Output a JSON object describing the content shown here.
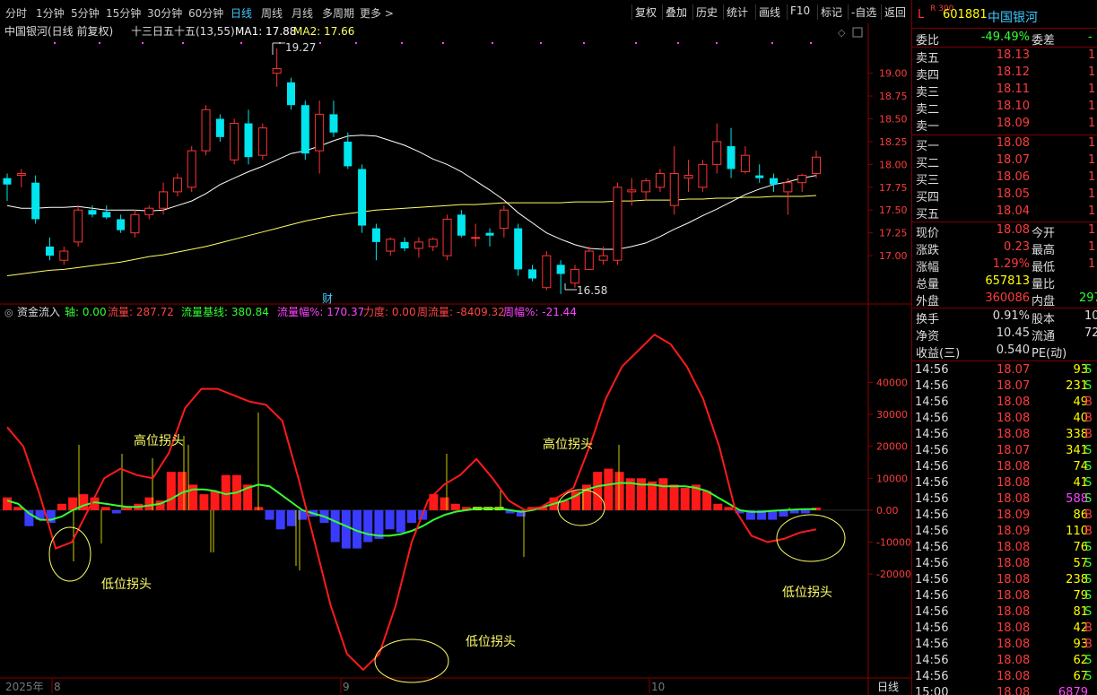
{
  "toolbar": {
    "timeframes": [
      "分时",
      "1分钟",
      "5分钟",
      "15分钟",
      "30分钟",
      "60分钟",
      "日线",
      "周线",
      "月线",
      "多周期",
      "更多 >"
    ],
    "active": "日线",
    "buttons": [
      "复权",
      "叠加",
      "历史",
      "统计",
      "画线",
      "F10",
      "标记",
      "-自选",
      "返回"
    ]
  },
  "price_panel": {
    "title": "中国银河(日线 前复权)",
    "indicator": "十三日五十五(13,55)",
    "ma1_label": "MA1: 17.88",
    "ma2_label": "MA2: 17.66",
    "high_label": "19.27",
    "low_label": "16.58",
    "marker": "财",
    "yticks": [
      "19.00",
      "18.75",
      "18.50",
      "18.25",
      "18.00",
      "17.75",
      "17.50",
      "17.25",
      "17.00"
    ],
    "colors": {
      "up": "#ff3333",
      "down": "#00e5ee",
      "ma1": "#ffffff",
      "ma2": "#ffff66"
    }
  },
  "flow_panel": {
    "title": "资金流入",
    "axis": "轴: 0.00",
    "flow": "流量: 287.72",
    "baseline": "流量基线: 380.84",
    "flow_pct": "流量幅%: 170.37",
    "force": "力度: 0.00",
    "week_flow": "周流量: -8409.32",
    "week_pct": "周幅%: -21.44",
    "yticks": [
      "40000",
      "30000",
      "20000",
      "10000",
      "0.00",
      "-10000",
      "-20000"
    ],
    "annotations": [
      "高位拐头",
      "低位拐头",
      "低位拐头",
      "高位拐头",
      "低位拐头"
    ]
  },
  "xaxis": {
    "labels": [
      "2025年",
      "8",
      "9",
      "10"
    ],
    "period": "日线"
  },
  "quote": {
    "market": "L",
    "index_tag": "R 300",
    "code": "601881",
    "name": "中国银河",
    "wb_label": "委比",
    "wb_value": "-49.49%",
    "wc_label": "委差",
    "wc_value": "-",
    "asks": [
      {
        "l": "卖五",
        "p": "18.13",
        "v": "1"
      },
      {
        "l": "卖四",
        "p": "18.12",
        "v": "1"
      },
      {
        "l": "卖三",
        "p": "18.11",
        "v": "1"
      },
      {
        "l": "卖二",
        "p": "18.10",
        "v": "1"
      },
      {
        "l": "卖一",
        "p": "18.09",
        "v": "1"
      }
    ],
    "bids": [
      {
        "l": "买一",
        "p": "18.08",
        "v": "1"
      },
      {
        "l": "买二",
        "p": "18.07",
        "v": "1"
      },
      {
        "l": "买三",
        "p": "18.06",
        "v": "1"
      },
      {
        "l": "买四",
        "p": "18.05",
        "v": "1"
      },
      {
        "l": "买五",
        "p": "18.04",
        "v": "1"
      }
    ],
    "stats": [
      {
        "l": "现价",
        "v": "18.08",
        "s": "今开",
        "x": "1"
      },
      {
        "l": "涨跌",
        "v": "0.23",
        "s": "最高",
        "x": "1"
      },
      {
        "l": "涨幅",
        "v": "1.29%",
        "s": "最低",
        "x": "1"
      },
      {
        "l": "总量",
        "v": "657813",
        "s": "量比",
        "x": ""
      },
      {
        "l": "外盘",
        "v": "360086",
        "s": "内盘",
        "x": "297"
      }
    ],
    "stats2": [
      {
        "l": "换手",
        "v": "0.91%",
        "s": "股本",
        "x": "10"
      },
      {
        "l": "净资",
        "v": "10.45",
        "s": "流通",
        "x": "72"
      },
      {
        "l": "收益(三)",
        "v": "0.540",
        "s": "PE(动)",
        "x": ""
      }
    ],
    "ticks": [
      [
        "14:56",
        "18.07",
        "93",
        "S"
      ],
      [
        "14:56",
        "18.07",
        "231",
        "S"
      ],
      [
        "14:56",
        "18.08",
        "49",
        "B"
      ],
      [
        "14:56",
        "18.08",
        "40",
        "B"
      ],
      [
        "14:56",
        "18.08",
        "338",
        "B"
      ],
      [
        "14:56",
        "18.07",
        "341",
        "S"
      ],
      [
        "14:56",
        "18.08",
        "74",
        "S"
      ],
      [
        "14:56",
        "18.08",
        "41",
        "S"
      ],
      [
        "14:56",
        "18.08",
        "588",
        "S"
      ],
      [
        "14:56",
        "18.09",
        "86",
        "B"
      ],
      [
        "14:56",
        "18.09",
        "110",
        "B"
      ],
      [
        "14:56",
        "18.08",
        "76",
        "S"
      ],
      [
        "14:56",
        "18.08",
        "57",
        "S"
      ],
      [
        "14:56",
        "18.08",
        "238",
        "S"
      ],
      [
        "14:56",
        "18.08",
        "79",
        "S"
      ],
      [
        "14:56",
        "18.08",
        "81",
        "S"
      ],
      [
        "14:56",
        "18.08",
        "42",
        "B"
      ],
      [
        "14:56",
        "18.08",
        "93",
        "B"
      ],
      [
        "14:56",
        "18.08",
        "62",
        "S"
      ],
      [
        "14:56",
        "18.08",
        "67",
        "S"
      ],
      [
        "15:00",
        "18.08",
        "6879",
        ""
      ]
    ]
  },
  "chart_data": {
    "type": "candlestick",
    "price_axis": {
      "min": 16.5,
      "max": 19.35
    },
    "candles": [
      [
        17.85,
        17.9,
        17.6,
        17.78
      ],
      [
        17.88,
        17.95,
        17.75,
        17.9
      ],
      [
        17.8,
        17.88,
        17.35,
        17.4
      ],
      [
        17.1,
        17.2,
        16.95,
        17.0
      ],
      [
        16.95,
        17.1,
        16.9,
        17.05
      ],
      [
        17.15,
        17.55,
        17.1,
        17.5
      ],
      [
        17.5,
        17.55,
        17.42,
        17.45
      ],
      [
        17.48,
        17.55,
        17.4,
        17.42
      ],
      [
        17.4,
        17.45,
        17.25,
        17.28
      ],
      [
        17.25,
        17.5,
        17.2,
        17.45
      ],
      [
        17.45,
        17.55,
        17.4,
        17.52
      ],
      [
        17.52,
        17.8,
        17.45,
        17.7
      ],
      [
        17.7,
        17.9,
        17.65,
        17.85
      ],
      [
        17.75,
        18.2,
        17.7,
        18.15
      ],
      [
        18.15,
        18.65,
        18.1,
        18.6
      ],
      [
        18.5,
        18.55,
        18.25,
        18.3
      ],
      [
        18.05,
        18.5,
        18.0,
        18.45
      ],
      [
        18.45,
        18.6,
        18.0,
        18.08
      ],
      [
        18.1,
        18.45,
        18.05,
        18.4
      ],
      [
        19.0,
        19.27,
        18.85,
        19.05
      ],
      [
        18.9,
        18.95,
        18.6,
        18.65
      ],
      [
        18.65,
        18.7,
        18.05,
        18.12
      ],
      [
        18.15,
        18.7,
        17.9,
        18.55
      ],
      [
        18.55,
        18.7,
        18.3,
        18.35
      ],
      [
        18.25,
        18.35,
        17.95,
        17.98
      ],
      [
        17.95,
        18.0,
        17.25,
        17.33
      ],
      [
        17.3,
        17.35,
        16.95,
        17.15
      ],
      [
        17.05,
        17.2,
        17.0,
        17.18
      ],
      [
        17.15,
        17.2,
        17.05,
        17.08
      ],
      [
        17.08,
        17.2,
        16.98,
        17.15
      ],
      [
        17.1,
        17.2,
        17.05,
        17.18
      ],
      [
        17.0,
        17.45,
        16.95,
        17.4
      ],
      [
        17.45,
        17.5,
        17.2,
        17.22
      ],
      [
        17.2,
        17.35,
        17.1,
        17.2
      ],
      [
        17.25,
        17.3,
        17.1,
        17.22
      ],
      [
        17.3,
        17.55,
        17.2,
        17.5
      ],
      [
        17.3,
        17.35,
        16.78,
        16.85
      ],
      [
        16.85,
        16.9,
        16.72,
        16.75
      ],
      [
        16.65,
        17.05,
        16.62,
        17.0
      ],
      [
        16.9,
        16.95,
        16.58,
        16.8
      ],
      [
        16.7,
        16.9,
        16.65,
        16.85
      ],
      [
        16.85,
        17.1,
        16.85,
        17.05
      ],
      [
        16.95,
        17.1,
        16.9,
        17.0
      ],
      [
        16.95,
        17.8,
        16.9,
        17.75
      ],
      [
        17.7,
        17.85,
        17.55,
        17.72
      ],
      [
        17.7,
        17.85,
        17.6,
        17.82
      ],
      [
        17.75,
        17.95,
        17.7,
        17.9
      ],
      [
        17.55,
        18.2,
        17.45,
        17.9
      ],
      [
        17.85,
        18.05,
        17.7,
        17.88
      ],
      [
        17.75,
        18.05,
        17.7,
        18.0
      ],
      [
        18.0,
        18.45,
        17.9,
        18.25
      ],
      [
        18.2,
        18.4,
        17.85,
        17.95
      ],
      [
        17.92,
        18.2,
        17.9,
        18.1
      ],
      [
        17.88,
        18.0,
        17.8,
        17.85
      ],
      [
        17.85,
        17.9,
        17.7,
        17.78
      ],
      [
        17.7,
        17.85,
        17.45,
        17.8
      ],
      [
        17.8,
        17.9,
        17.7,
        17.88
      ],
      [
        17.9,
        18.15,
        17.85,
        18.08
      ]
    ],
    "ma1": [
      17.55,
      17.52,
      17.52,
      17.53,
      17.53,
      17.54,
      17.52,
      17.5,
      17.5,
      17.5,
      17.49,
      17.5,
      17.55,
      17.6,
      17.68,
      17.78,
      17.85,
      17.92,
      17.98,
      18.05,
      18.12,
      18.15,
      18.2,
      18.26,
      18.31,
      18.32,
      18.31,
      18.26,
      18.21,
      18.14,
      18.06,
      18.0,
      17.92,
      17.82,
      17.72,
      17.61,
      17.47,
      17.36,
      17.25,
      17.18,
      17.12,
      17.08,
      17.07,
      17.07,
      17.1,
      17.14,
      17.21,
      17.29,
      17.36,
      17.44,
      17.51,
      17.59,
      17.67,
      17.73,
      17.78,
      17.81,
      17.85,
      17.88
    ],
    "ma2": [
      16.78,
      16.8,
      16.82,
      16.84,
      16.85,
      16.87,
      16.89,
      16.91,
      16.93,
      16.96,
      16.99,
      17.01,
      17.04,
      17.07,
      17.1,
      17.14,
      17.18,
      17.22,
      17.26,
      17.3,
      17.34,
      17.38,
      17.41,
      17.44,
      17.46,
      17.48,
      17.5,
      17.51,
      17.52,
      17.53,
      17.54,
      17.55,
      17.56,
      17.56,
      17.57,
      17.58,
      17.58,
      17.58,
      17.58,
      17.58,
      17.59,
      17.59,
      17.59,
      17.6,
      17.6,
      17.61,
      17.61,
      17.61,
      17.62,
      17.62,
      17.63,
      17.63,
      17.64,
      17.64,
      17.65,
      17.65,
      17.65,
      17.66
    ],
    "flow_axis": {
      "min": -52000,
      "max": 57000
    },
    "flow_bars": [
      4000,
      1000,
      -5000,
      -3000,
      -4000,
      2000,
      4000,
      5000,
      4000,
      1000,
      -1000,
      1000,
      2000,
      4000,
      3000,
      12000,
      12000,
      8000,
      5000,
      6000,
      11000,
      11000,
      8000,
      1000,
      -3000,
      -6000,
      -5000,
      -3000,
      -2000,
      -4000,
      -10000,
      -12000,
      -12000,
      -10000,
      -9000,
      -6000,
      -7000,
      -4000,
      -3000,
      5000,
      4000,
      2000,
      1000,
      1000,
      1000,
      1000,
      -1000,
      -2000,
      1000,
      1000,
      4000,
      3000,
      6000,
      8000,
      12000,
      13000,
      12000,
      10000,
      10000,
      9000,
      10000,
      8000,
      7000,
      8000,
      6000,
      2000,
      1000,
      -1000,
      -3000,
      -3000,
      -3000,
      -2000,
      -1000,
      -1000,
      800
    ],
    "flow_bar_colors": [
      "red",
      "red",
      "blue",
      "blue",
      "blue",
      "red",
      "red",
      "red",
      "red",
      "red",
      "blue",
      "red",
      "red",
      "red",
      "red",
      "red",
      "red",
      "red",
      "red",
      "red",
      "red",
      "red",
      "red",
      "red",
      "blue",
      "blue",
      "blue",
      "blue",
      "blue",
      "blue",
      "blue",
      "blue",
      "blue",
      "blue",
      "blue",
      "blue",
      "blue",
      "blue",
      "blue",
      "red",
      "red",
      "red",
      "red",
      "yellow",
      "yellow",
      "yellow",
      "blue",
      "blue",
      "red",
      "red",
      "red",
      "red",
      "red",
      "red",
      "red",
      "red",
      "red",
      "red",
      "red",
      "red",
      "red",
      "red",
      "red",
      "red",
      "red",
      "red",
      "red",
      "blue",
      "blue",
      "blue",
      "blue",
      "blue",
      "blue",
      "blue",
      "red"
    ],
    "flow_baseline": [
      3000,
      2000,
      -1000,
      -3000,
      -3000,
      -2000,
      0,
      1500,
      2500,
      2000,
      1500,
      1000,
      1000,
      1500,
      2000,
      3500,
      5500,
      6500,
      6500,
      6000,
      5000,
      5500,
      7000,
      8000,
      7500,
      5000,
      2500,
      0,
      -1000,
      -2000,
      -3500,
      -5000,
      -6500,
      -7500,
      -8000,
      -8000,
      -7500,
      -6500,
      -5000,
      -3000,
      -1500,
      -500,
      0,
      500,
      500,
      500,
      0,
      -500,
      0,
      1000,
      2000,
      3000,
      4500,
      6500,
      7500,
      8000,
      8500,
      8500,
      8000,
      8000,
      7500,
      7500,
      7500,
      7000,
      6000,
      4000,
      2000,
      0,
      -500,
      -500,
      -200,
      0,
      200,
      300,
      300
    ],
    "flow_line": [
      26000,
      20000,
      5000,
      -12000,
      -10000,
      0,
      10000,
      13000,
      11000,
      10000,
      18000,
      32000,
      38000,
      38000,
      36000,
      34000,
      33000,
      28000,
      10000,
      -10000,
      -30000,
      -45000,
      -50000,
      -45000,
      -30000,
      -10000,
      3000,
      8000,
      11000,
      16000,
      10000,
      3000,
      0,
      1000,
      4000,
      7000,
      20000,
      35000,
      45000,
      50000,
      55000,
      52000,
      45000,
      35000,
      20000,
      0,
      -8000,
      -10000,
      -9000,
      -7000,
      -6000
    ]
  }
}
